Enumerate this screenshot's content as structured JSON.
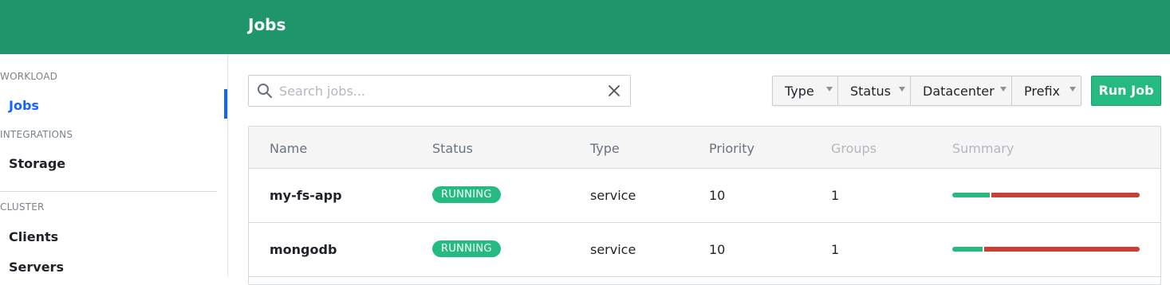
{
  "header": {
    "title": "Jobs"
  },
  "sidebar": {
    "sections": [
      {
        "label": "WORKLOAD",
        "items": [
          {
            "label": "Jobs",
            "active": true
          }
        ]
      },
      {
        "label": "INTEGRATIONS",
        "items": [
          {
            "label": "Storage",
            "active": false
          }
        ]
      },
      {
        "label": "CLUSTER",
        "items": [
          {
            "label": "Clients",
            "active": false
          },
          {
            "label": "Servers",
            "active": false
          }
        ]
      }
    ]
  },
  "search": {
    "placeholder": "Search jobs...",
    "value": ""
  },
  "filters": [
    {
      "label": "Type"
    },
    {
      "label": "Status"
    },
    {
      "label": "Datacenter"
    },
    {
      "label": "Prefix"
    }
  ],
  "run_job_label": "Run Job",
  "table": {
    "columns": [
      "Name",
      "Status",
      "Type",
      "Priority",
      "Groups",
      "Summary"
    ],
    "rows": [
      {
        "name": "my-fs-app",
        "status": "RUNNING",
        "type": "service",
        "priority": "10",
        "groups": "1",
        "summary": {
          "running_fraction": 0.2,
          "failed_fraction": 0.8
        }
      },
      {
        "name": "mongodb",
        "status": "RUNNING",
        "type": "service",
        "priority": "10",
        "groups": "1",
        "summary": {
          "running_fraction": 0.16,
          "failed_fraction": 0.84
        }
      }
    ]
  },
  "colors": {
    "header_bg": "#1e9669",
    "accent_blue": "#1563ff",
    "running_green": "#25ba81",
    "failed_red": "#c84034"
  }
}
